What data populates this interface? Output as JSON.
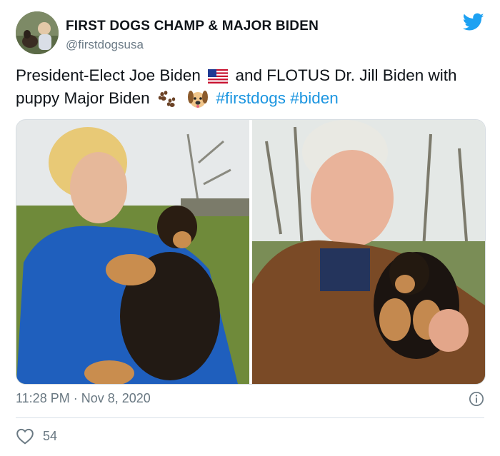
{
  "tweet": {
    "display_name": "FIRST DOGS CHAMP & MAJOR BIDEN",
    "handle": "@firstdogsusa",
    "text_part1": "President-Elect Joe Biden",
    "text_part2": "and FLOTUS Dr. Jill Biden with puppy Major Biden",
    "hashtag1": "#firstdogs",
    "hashtag2": "#biden",
    "timestamp": "11:28 PM · Nov 8, 2020",
    "like_count": "54"
  },
  "icons": {
    "brand": "twitter-bird-icon",
    "flag": "us-flag-emoji",
    "paws": "paw-prints-emoji",
    "dog": "dog-face-emoji",
    "info": "info-icon",
    "like": "heart-icon"
  },
  "colors": {
    "brand_blue": "#1da1f2",
    "hashtag": "#1b95e0",
    "meta_gray": "#697882"
  }
}
